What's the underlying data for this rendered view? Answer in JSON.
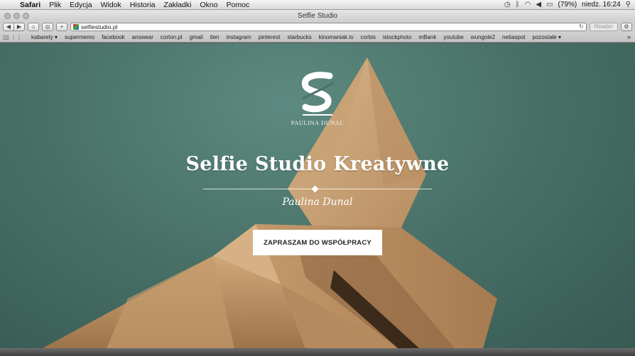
{
  "menubar": {
    "app": "Safari",
    "items": [
      "Plik",
      "Edycja",
      "Widok",
      "Historia",
      "Zakładki",
      "Okno",
      "Pomoc"
    ],
    "battery": "(79%)",
    "clock": "niedz. 16:24"
  },
  "window": {
    "title": "Selfie Studio"
  },
  "toolbar": {
    "back": "◀",
    "forward": "▶",
    "home": "⌂",
    "add": "+",
    "url": "selfiestudio.pl",
    "reader": "Reader"
  },
  "bookmarks": {
    "items": [
      "kabarety ▾",
      "supermemo",
      "facebook",
      "answear",
      "corton.pl",
      "gmail",
      "tlen",
      "instagram",
      "pinterest",
      "starbucks",
      "kinomaniak.tv",
      "corbis",
      "istockphoto",
      "mBank",
      "youtube",
      "wungole2",
      "netiaspot",
      "pozostałe ▾"
    ],
    "more": "»"
  },
  "hero": {
    "logo_caption": "PAULINA DUNAL",
    "headline": "Selfie Studio Kreatywne",
    "signature": "Paulina Dunal",
    "cta": "ZAPRASZAM DO WSPÓŁPRACY"
  },
  "colors": {
    "background_teal": "#4a7269",
    "paper_kraft": "#c9a37a",
    "cta_bg": "#ffffff"
  }
}
